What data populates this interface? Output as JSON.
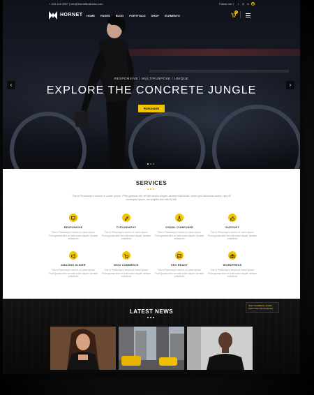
{
  "topbar": {
    "contact": "+ 444 123 4567 | info@hornetbusiness.com",
    "follow_label": "Follow me"
  },
  "nav": {
    "logo": "HORNET",
    "menu": [
      "HOME",
      "PAGES",
      "BLOG",
      "PORTFOLIO",
      "SHOP",
      "ELEMENTS"
    ],
    "cart_count": "0"
  },
  "hero": {
    "tagline": "RESPONSIVE  /  MULTIPURPOSE  /  UNIQUE",
    "headline": "EXPLORE THE CONCRETE JUNGLE",
    "button": "PURCHASE"
  },
  "services": {
    "title": "SERVICES",
    "intro": "This is Photoshop's version  of Lorem Ipsum. Proin gravida nibh vel velit auctor aliquet. Aenean sollicitudin, lorem quis bibendum auctor, nisi elit consequat ipsum, nec sagittis sem nibh id elit.",
    "items": [
      {
        "name": "RESPONSIVE",
        "desc": "This is Photoshop's version  of Lorem Ipsum. Proin gravida nibh vel velit auctor aliquet. Aenean sollicitudin"
      },
      {
        "name": "TYPOGRAPHY",
        "desc": "This is Photoshop's version  of Lorem Ipsum. Proin gravida nibh vel velit auctor aliquet. Aenean sollicitudin"
      },
      {
        "name": "VISUAL COMPOSER",
        "desc": "This is Photoshop's version  of Lorem Ipsum. Proin gravida nibh vel velit auctor aliquet. Aenean sollicitudin"
      },
      {
        "name": "SUPPORT",
        "desc": "This is Photoshop's version  of Lorem Ipsum. Proin gravida nibh vel velit auctor aliquet. Aenean sollicitudin"
      },
      {
        "name": "AMAZING SLIDER",
        "desc": "This is Photoshop's version  of Lorem Ipsum. Proin gravida nibh vel velit auctor aliquet. Aenean sollicitudin"
      },
      {
        "name": "WOO COMMERCE",
        "desc": "This is Photoshop's version  of Lorem Ipsum. Proin gravida nibh vel velit auctor aliquet. Aenean sollicitudin"
      },
      {
        "name": "SEO READY",
        "desc": "This is Photoshop's version  of Lorem Ipsum. Proin gravida nibh vel velit auctor aliquet. Aenean sollicitudin"
      },
      {
        "name": "WORDPRESS",
        "desc": "This is Photoshop's version  of Lorem Ipsum. Proin gravida nibh vel velit auctor aliquet. Aenean sollicitudin"
      }
    ]
  },
  "news": {
    "title": "LATEST NEWS",
    "notice_title": "NEW THUMBNAIL SLIDES",
    "notice_text": "Latest news with thumbnails"
  },
  "colors": {
    "accent": "#f2c500",
    "hero_bg": "#141822",
    "news_bg": "#2b2b2b"
  }
}
